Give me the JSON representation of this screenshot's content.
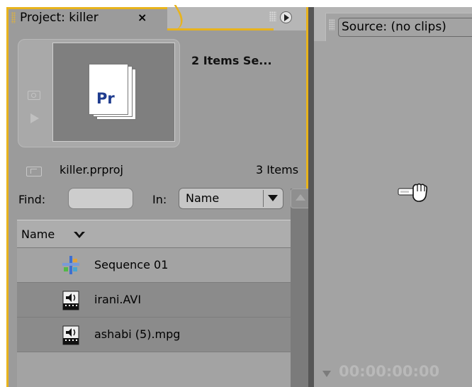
{
  "project_panel": {
    "tab_label": "Project: killer",
    "close_glyph": "×",
    "preview_title": "2 Items Se...",
    "thumbnail_text": "Pr",
    "project_filename": "killer.prproj",
    "item_count": "3 Items",
    "find_label": "Find:",
    "find_value": "",
    "in_label": "In:",
    "in_selected": "Name",
    "list_header": "Name",
    "items": [
      {
        "label": "Sequence 01",
        "icon": "sequence-icon"
      },
      {
        "label": "irani.AVI",
        "icon": "video-audio-clip-icon"
      },
      {
        "label": "ashabi (5).mpg",
        "icon": "video-audio-clip-icon"
      }
    ]
  },
  "source_panel": {
    "tab_label": "Source: (no clips)",
    "timecode": "00:00:00:00"
  },
  "colors": {
    "active_panel_border": "#e8b31c",
    "panel_bg": "#9b9b9b",
    "selected_row_bg": "#8b8b8b",
    "pr_brand": "#1f3c8f"
  }
}
